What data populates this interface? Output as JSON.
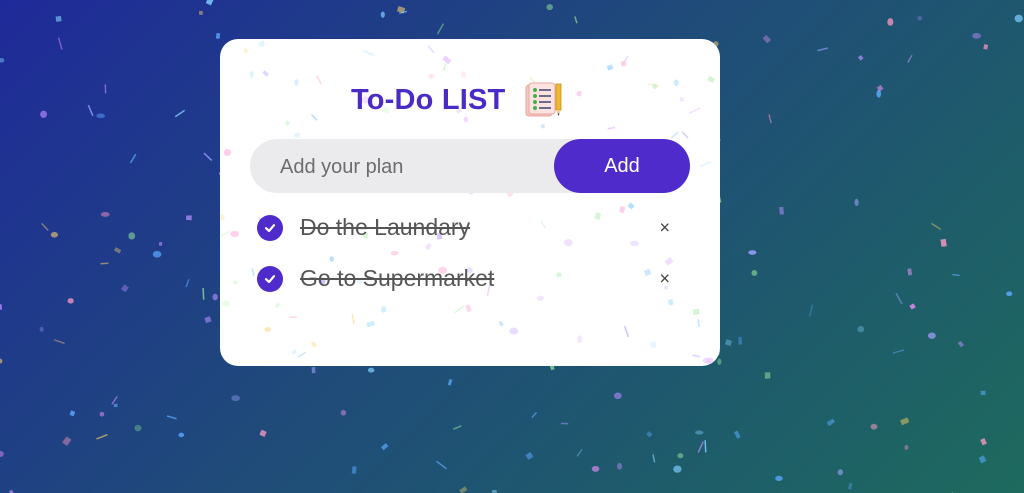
{
  "app": {
    "title": "To-Do LIST",
    "title_icon": "checklist-notepad-icon"
  },
  "input": {
    "placeholder": "Add your plan",
    "value": ""
  },
  "buttons": {
    "add_label": "Add"
  },
  "tasks": [
    {
      "text": "Do the Laundary",
      "completed": true,
      "delete_label": "×"
    },
    {
      "text": "Go to Supermarket",
      "completed": true,
      "delete_label": "×"
    }
  ],
  "colors": {
    "accent": "#4f2bcc",
    "title": "#4b2bc6",
    "card": "#ffffff",
    "input_bg": "#ebebee",
    "bg_start": "#1f2a9a",
    "bg_end": "#1e6a5e"
  },
  "icons": {
    "check": "checkmark-icon",
    "delete": "close-icon",
    "title": "checklist-notepad-icon"
  }
}
